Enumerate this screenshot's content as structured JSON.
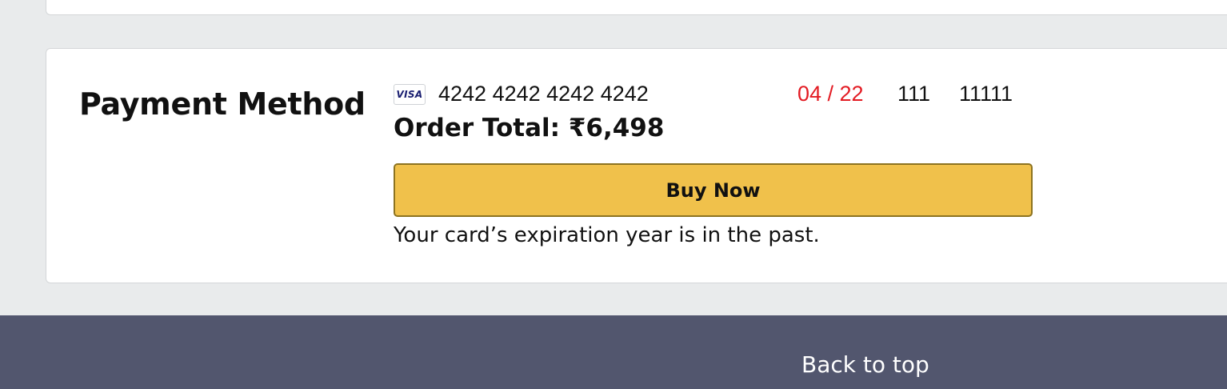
{
  "payment": {
    "title": "Payment Method",
    "card": {
      "brand_icon": "visa-icon",
      "brand_text": "VISA",
      "number": "4242 4242 4242 4242",
      "expiry": "04 / 22",
      "cvc": "111",
      "zip": "11111"
    },
    "order_total": "Order Total: ₹6,498",
    "buy_button_label": "Buy Now",
    "error_message": "Your card’s expiration year is in the past."
  },
  "footer": {
    "back_to_top_label": "Back to top"
  },
  "colors": {
    "page_background": "#e9ebec",
    "card_background": "#ffffff",
    "error_red": "#e31b23",
    "button_yellow": "#f0c14b",
    "footer_background": "#52566e"
  }
}
